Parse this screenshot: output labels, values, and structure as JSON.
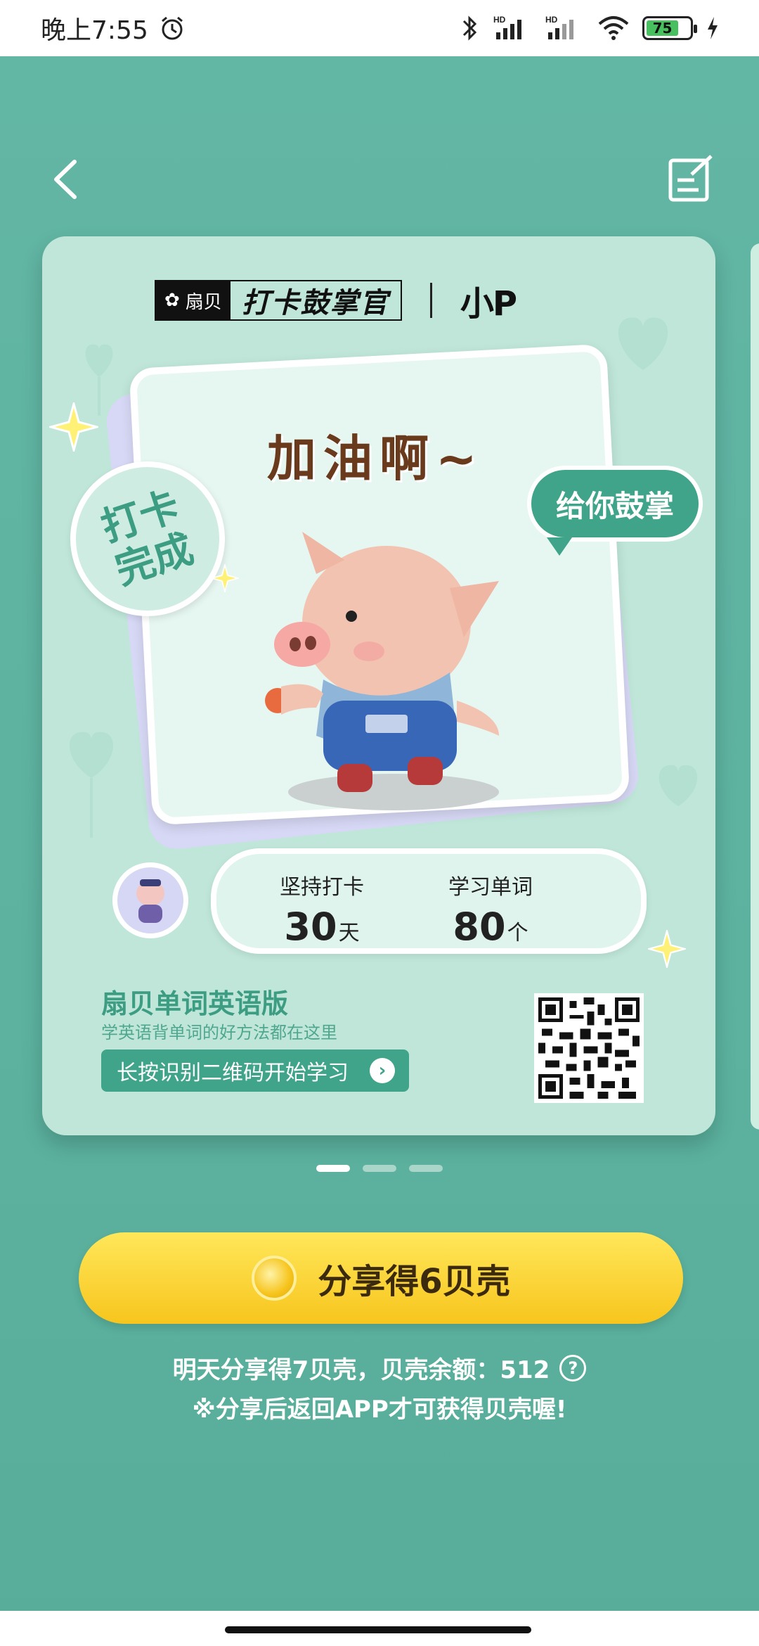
{
  "status_bar": {
    "time": "晚上7:55",
    "battery_level": "75"
  },
  "card": {
    "brand": {
      "left_logo_small": "扇贝",
      "left_logo_title": "打卡鼓掌官",
      "right_logo": "小P"
    },
    "cheer": "加油啊~",
    "badge": "打卡\n完成",
    "bubble": "给你鼓掌",
    "stats": {
      "days_label": "坚持打卡",
      "days_value": "30",
      "days_unit": "天",
      "words_label": "学习单词",
      "words_value": "80",
      "words_unit": "个"
    },
    "app_name": "扇贝单词英语版",
    "app_subtitle": "学英语背单词的好方法都在这里",
    "qr_hint": "长按识别二维码开始学习"
  },
  "pager": {
    "total": 3,
    "active": 1
  },
  "share_button": {
    "label": "分享得6贝壳"
  },
  "info": {
    "line1": "明天分享得7贝壳，贝壳余额：512",
    "line2": "※分享后返回APP才可获得贝壳喔!"
  },
  "colors": {
    "background": "#5fb3a0",
    "card": "#bfe6d9",
    "accent": "#3fa489",
    "button": "#f7c51d"
  }
}
